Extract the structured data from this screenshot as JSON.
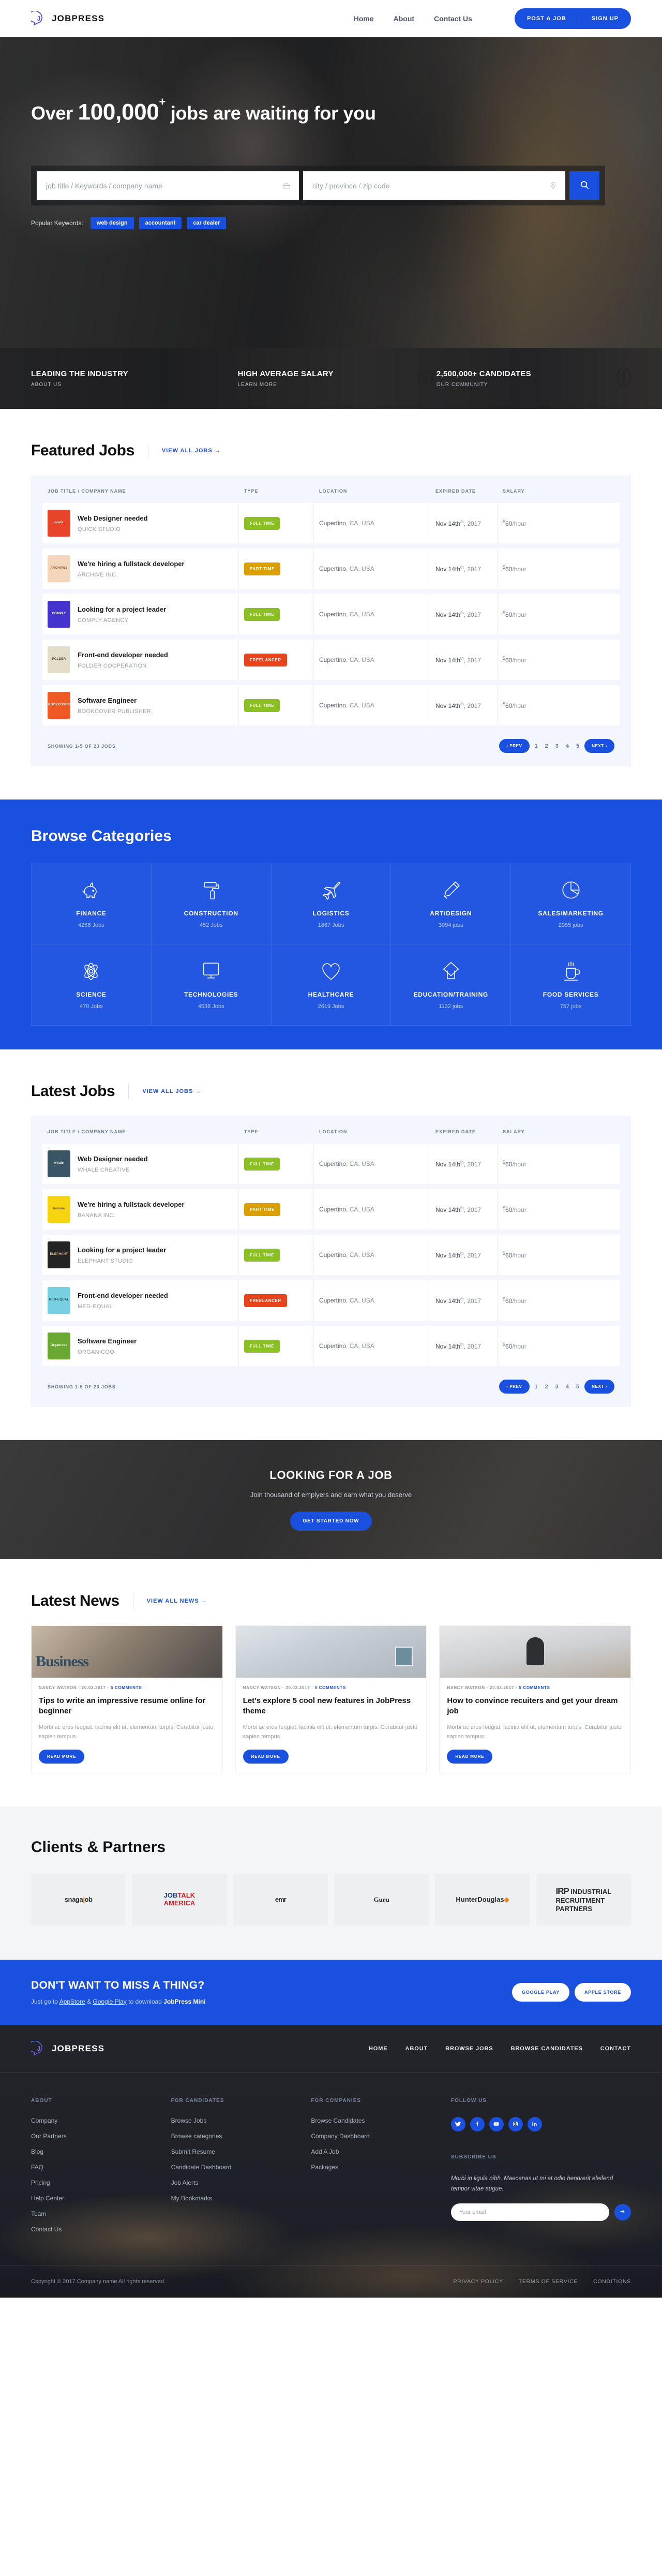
{
  "header": {
    "brand": "JOBPRESS",
    "brand_icon": "speech-bubble-j-logo",
    "nav": [
      {
        "label": "Home"
      },
      {
        "label": "About"
      },
      {
        "label": "Contact Us"
      }
    ],
    "post_job_label": "POST A JOB",
    "sign_up_label": "SIGN UP"
  },
  "hero": {
    "title_prefix": "Over ",
    "title_number": "100,000",
    "title_sup": "+",
    "title_suffix": " jobs are waiting for you",
    "keyword_placeholder": "job title / Keywords / company name",
    "keyword_value": "",
    "location_placeholder": "city / province / zip code",
    "location_value": "",
    "keyword_icon": "briefcase-icon",
    "location_icon": "map-pin-icon",
    "search_icon": "search-icon",
    "popular_label": "Popular Keywords:",
    "popular_chips": [
      "web design",
      "accountant",
      "car dealer"
    ],
    "accent": "#1a50e0"
  },
  "stats": [
    {
      "title": "LEADING THE INDUSTRY",
      "link": "ABOUT US",
      "icon": "trophy-icon"
    },
    {
      "title": "HIGH AVERAGE SALARY",
      "link": "LEARN MORE",
      "icon": "money-stack-icon"
    },
    {
      "title": "2,500,000+ CANDIDATES",
      "link": "OUR COMMUNITY",
      "icon": "person-icon"
    }
  ],
  "featured": {
    "heading": "Featured Jobs",
    "view_all": "VIEW ALL JOBS",
    "columns": [
      "JOB TITLE / COMPANY NAME",
      "TYPE",
      "LOCATION",
      "EXPIRED DATE",
      "SALARY"
    ],
    "rows": [
      {
        "logo_text": "quick",
        "logo_bg": "#e8442a",
        "logo_fg": "#ffffff",
        "title": "Web Designer needed",
        "company": "QUICK STUDIO",
        "type": "FULL TIME",
        "type_class": "full",
        "location_city": "Cupertino",
        "location_rest": ", CA, USA",
        "date_month": "Nov 14th",
        "date_sup": "th",
        "date_year": ", 2017",
        "currency": "$",
        "salary": "60",
        "salary_unit": "/hour"
      },
      {
        "logo_text": "ARCHIVES",
        "logo_bg": "#f4d6bd",
        "logo_fg": "#8a5c34",
        "title": "We're hiring a fullstack developer",
        "company": "ARCHIVE INC.",
        "type": "PART TIME",
        "type_class": "part",
        "location_city": "Cupertino",
        "location_rest": ", CA, USA",
        "date_month": "Nov 14th",
        "date_sup": "th",
        "date_year": ", 2017",
        "currency": "$",
        "salary": "60",
        "salary_unit": "/hour"
      },
      {
        "logo_text": "COMPLY",
        "logo_bg": "#4433cc",
        "logo_fg": "#ffffff",
        "title": "Looking for a project leader",
        "company": "COMPLY AGENCY",
        "type": "FULL TIME",
        "type_class": "full",
        "location_city": "Cupertino",
        "location_rest": ", CA, USA",
        "date_month": "Nov 14th",
        "date_sup": "th",
        "date_year": ", 2017",
        "currency": "$",
        "salary": "60",
        "salary_unit": "/hour"
      },
      {
        "logo_text": "FOLDER",
        "logo_bg": "#e2ddc9",
        "logo_fg": "#4a4535",
        "title": "Front-end developer needed",
        "company": "FOLDER COOPERATION",
        "type": "FREELANCER",
        "type_class": "free",
        "location_city": "Cupertino",
        "location_rest": ", CA, USA",
        "date_month": "Nov 14th",
        "date_sup": "th",
        "date_year": ", 2017",
        "currency": "$",
        "salary": "60",
        "salary_unit": "/hour"
      },
      {
        "logo_text": "BOOKCOVER",
        "logo_bg": "#ef5a24",
        "logo_fg": "#ffffff",
        "title": "Software Engineer",
        "company": "BOOKCOVER PUBLISHER",
        "type": "FULL TIME",
        "type_class": "full",
        "location_city": "Cupertino",
        "location_rest": ", CA, USA",
        "date_month": "Nov 14th",
        "date_sup": "th",
        "date_year": ", 2017",
        "currency": "$",
        "salary": "60",
        "salary_unit": "/hour"
      }
    ],
    "showing": "SHOWING 1-5 OF 23 JOBS",
    "prev": "‹ PREV",
    "next": "NEXT ›",
    "pages": [
      "1",
      "2",
      "3",
      "4",
      "5"
    ]
  },
  "categories": {
    "heading": "Browse Categories",
    "items": [
      {
        "name": "FINANCE",
        "count": "4286 Jobs",
        "icon": "piggy-bank-icon"
      },
      {
        "name": "CONSTRUCTION",
        "count": "452 Jobs",
        "icon": "paint-roller-icon"
      },
      {
        "name": "LOGISTICS",
        "count": "1867 Jobs",
        "icon": "airplane-icon"
      },
      {
        "name": "ART/DESIGN",
        "count": "3094 jobs",
        "icon": "pencil-icon"
      },
      {
        "name": "SALES/MARKETING",
        "count": "2955 jobs",
        "icon": "pie-chart-icon"
      },
      {
        "name": "SCIENCE",
        "count": "470 Jobs",
        "icon": "atom-icon"
      },
      {
        "name": "TECHNOLOGIES",
        "count": "4536 Jobs",
        "icon": "monitor-icon"
      },
      {
        "name": "HEALTHCARE",
        "count": "2619 Jobs",
        "icon": "heart-icon"
      },
      {
        "name": "EDUCATION/TRAINING",
        "count": "1132 jobs",
        "icon": "graduation-cap-icon"
      },
      {
        "name": "FOOD SERVICES",
        "count": "757 jobs",
        "icon": "coffee-cup-icon"
      }
    ]
  },
  "latest": {
    "heading": "Latest Jobs",
    "view_all": "VIEW ALL JOBS",
    "columns": [
      "JOB TITLE / COMPANY NAME",
      "TYPE",
      "LOCATION",
      "EXPIRED DATE",
      "SALARY"
    ],
    "rows": [
      {
        "logo_text": "whale",
        "logo_bg": "#3a5566",
        "logo_fg": "#ffffff",
        "title": "Web Designer needed",
        "company": "WHALE CREATIVE",
        "type": "FULL TIME",
        "type_class": "full",
        "location_city": "Cupertino",
        "location_rest": ", CA, USA",
        "date_month": "Nov 14th",
        "date_sup": "th",
        "date_year": ", 2017",
        "currency": "$",
        "salary": "60",
        "salary_unit": "/hour"
      },
      {
        "logo_text": "banana",
        "logo_bg": "#f6d510",
        "logo_fg": "#6a5500",
        "title": "We're hiring a fullstack developer",
        "company": "BANANA INC.",
        "type": "PART TIME",
        "type_class": "part",
        "location_city": "Cupertino",
        "location_rest": ", CA, USA",
        "date_month": "Nov 14th",
        "date_sup": "th",
        "date_year": ", 2017",
        "currency": "$",
        "salary": "60",
        "salary_unit": "/hour"
      },
      {
        "logo_text": "ELEPHANT",
        "logo_bg": "#242424",
        "logo_fg": "#d8b48a",
        "title": "Looking for a project leader",
        "company": "ELEPHANT STUDIO",
        "type": "FULL TIME",
        "type_class": "full",
        "location_city": "Cupertino",
        "location_rest": ", CA, USA",
        "date_month": "Nov 14th",
        "date_sup": "th",
        "date_year": ", 2017",
        "currency": "$",
        "salary": "60",
        "salary_unit": "/hour"
      },
      {
        "logo_text": "MED-EQUAL",
        "logo_bg": "#78cfe2",
        "logo_fg": "#1d4a58",
        "title": "Front-end developer needed",
        "company": "MED-EQUAL",
        "type": "FREELANCER",
        "type_class": "free",
        "location_city": "Cupertino",
        "location_rest": ", CA, USA",
        "date_month": "Nov 14th",
        "date_sup": "th",
        "date_year": ", 2017",
        "currency": "$",
        "salary": "60",
        "salary_unit": "/hour"
      },
      {
        "logo_text": "Organicoo",
        "logo_bg": "#6aa832",
        "logo_fg": "#ffffff",
        "title": "Software Engineer",
        "company": "ORGANICOO",
        "type": "FULL TIME",
        "type_class": "full",
        "location_city": "Cupertino",
        "location_rest": ", CA, USA",
        "date_month": "Nov 14th",
        "date_sup": "th",
        "date_year": ", 2017",
        "currency": "$",
        "salary": "60",
        "salary_unit": "/hour"
      }
    ],
    "showing": "SHOWING 1-5 OF 23 JOBS",
    "prev": "‹ PREV",
    "next": "NEXT ›",
    "pages": [
      "1",
      "2",
      "3",
      "4",
      "5"
    ]
  },
  "job_cta": {
    "title": "LOOKING FOR A JOB",
    "subtitle": "Join thousand of emplyers and earn what you deserve",
    "button": "GET STARTED NOW"
  },
  "news": {
    "heading": "Latest News",
    "view_all": "VIEW ALL NEWS",
    "cards": [
      {
        "author": "NANCY WATSON",
        "date": "20.02.2017",
        "comments": "5 COMMENTS",
        "title": "Tips to write an impressive resume online for beginner",
        "excerpt": "Morbi ac eros feugiat, lacinia elit ut, elementum turpis. Curabitur justo sapien tempus.",
        "button": "READ MORE",
        "img": "a"
      },
      {
        "author": "NANCY WATSON",
        "date": "20.02.2017",
        "comments": "5 COMMENTS",
        "title": "Let's explore 5 cool new features in JobPress theme",
        "excerpt": "Morbi ac eros feugiat, lacinia elit ut, elementum turpis. Curabitur justo sapien tempus.",
        "button": "READ MORE",
        "img": "b"
      },
      {
        "author": "NANCY WATSON",
        "date": "20.02.2017",
        "comments": "5 COMMENTS",
        "title": "How to convince recuiters and get your dream job",
        "excerpt": "Morbi ac eros feugiat, lacinia elit ut, elementum turpis. Curabitur justo sapien tempus.",
        "button": "READ MORE",
        "img": "c"
      }
    ]
  },
  "clients": {
    "heading": "Clients & Partners",
    "logos": [
      {
        "name": "snagajob",
        "kind": "snagajob"
      },
      {
        "name": "JOBTALK AMERICA",
        "kind": "jobtalk"
      },
      {
        "name": "emr",
        "kind": "emr"
      },
      {
        "name": "Guru",
        "kind": "guru"
      },
      {
        "name": "HunterDouglas",
        "kind": "hunterdouglas"
      },
      {
        "name": "IRP INDUSTRIAL RECRUITMENT PARTNERS",
        "kind": "irp"
      }
    ]
  },
  "app_band": {
    "title": "DON'T WANT TO MISS A THING?",
    "text_pre": "Just go to ",
    "link1": "AppStore",
    "text_mid": " & ",
    "link2": "Google Play",
    "text_post": " to download ",
    "app_name": "JobPress Mini",
    "google_play": "GOOGLE PLAY",
    "apple_store": "APPLE STORE"
  },
  "footer": {
    "brand": "JOBPRESS",
    "nav": [
      "HOME",
      "ABOUT",
      "BROWSE JOBS",
      "BROWSE CANDIDATES",
      "CONTACT"
    ],
    "columns": [
      {
        "heading": "ABOUT",
        "links": [
          "Company",
          "Our Partners",
          "Blog",
          "FAQ",
          "Pricing",
          "Help Center",
          "Team",
          "Contact Us"
        ]
      },
      {
        "heading": "FOR CANDIDATES",
        "links": [
          "Browse Jobs",
          "Browse categories",
          "Submit Resume",
          "Candidate Dashboard",
          "Job Alerts",
          "My Bookmarks"
        ]
      },
      {
        "heading": "FOR COMPANIES",
        "links": [
          "Browse Candidates",
          "Company Dashboard",
          "Add A Job",
          "Packages"
        ]
      }
    ],
    "follow_heading": "FOLLOW US",
    "socials": [
      {
        "name": "twitter-icon"
      },
      {
        "name": "facebook-icon"
      },
      {
        "name": "youtube-icon"
      },
      {
        "name": "instagram-icon"
      },
      {
        "name": "linkedin-icon"
      }
    ],
    "subscribe_heading": "SUBSCRIBE US",
    "subscribe_text": "Morbi in ligula nibh. Maecenas ut mi at odio hendrerit eleifend tempor vitae augue.",
    "email_placeholder": "Your email",
    "email_value": "",
    "submit_icon": "arrow-right-icon",
    "copyright": "Copyright © 2017.Company name All rights reserved.",
    "legal": [
      "PRIVACY POLICY",
      "TERMS OF SERVICE",
      "CONDITIONS"
    ]
  }
}
